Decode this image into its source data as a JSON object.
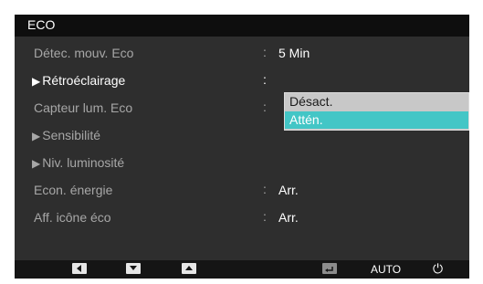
{
  "menu": {
    "title": "ECO",
    "items": [
      {
        "label": "Détec. mouv. Eco",
        "arrow": "",
        "colon": ":",
        "value": "5 Min"
      },
      {
        "label": "Rétroéclairage",
        "arrow": "▶",
        "colon": ":",
        "value": ""
      },
      {
        "label": "Capteur lum. Eco",
        "arrow": "",
        "colon": ":",
        "value": ""
      },
      {
        "label": "Sensibilité",
        "arrow": "▶",
        "colon": "",
        "value": ""
      },
      {
        "label": "Niv. luminosité",
        "arrow": "▶",
        "colon": "",
        "value": ""
      },
      {
        "label": "Econ. énergie",
        "arrow": "",
        "colon": ":",
        "value": "Arr."
      },
      {
        "label": "Aff. icône éco",
        "arrow": "",
        "colon": ":",
        "value": "Arr."
      }
    ]
  },
  "dropdown": {
    "options": [
      "Désact.",
      "Attén."
    ],
    "selected": "Attén."
  },
  "buttons": {
    "left": "left-arrow-icon",
    "down": "down-arrow-icon",
    "up": "up-arrow-icon",
    "enter": "enter-icon",
    "auto_label": "AUTO",
    "power": "power-icon"
  },
  "colors": {
    "panel_bg": "#2e2e2e",
    "titlebar_bg": "#0e0e0e",
    "highlight": "#43c6c6",
    "dim_text": "#a7a7a7"
  }
}
